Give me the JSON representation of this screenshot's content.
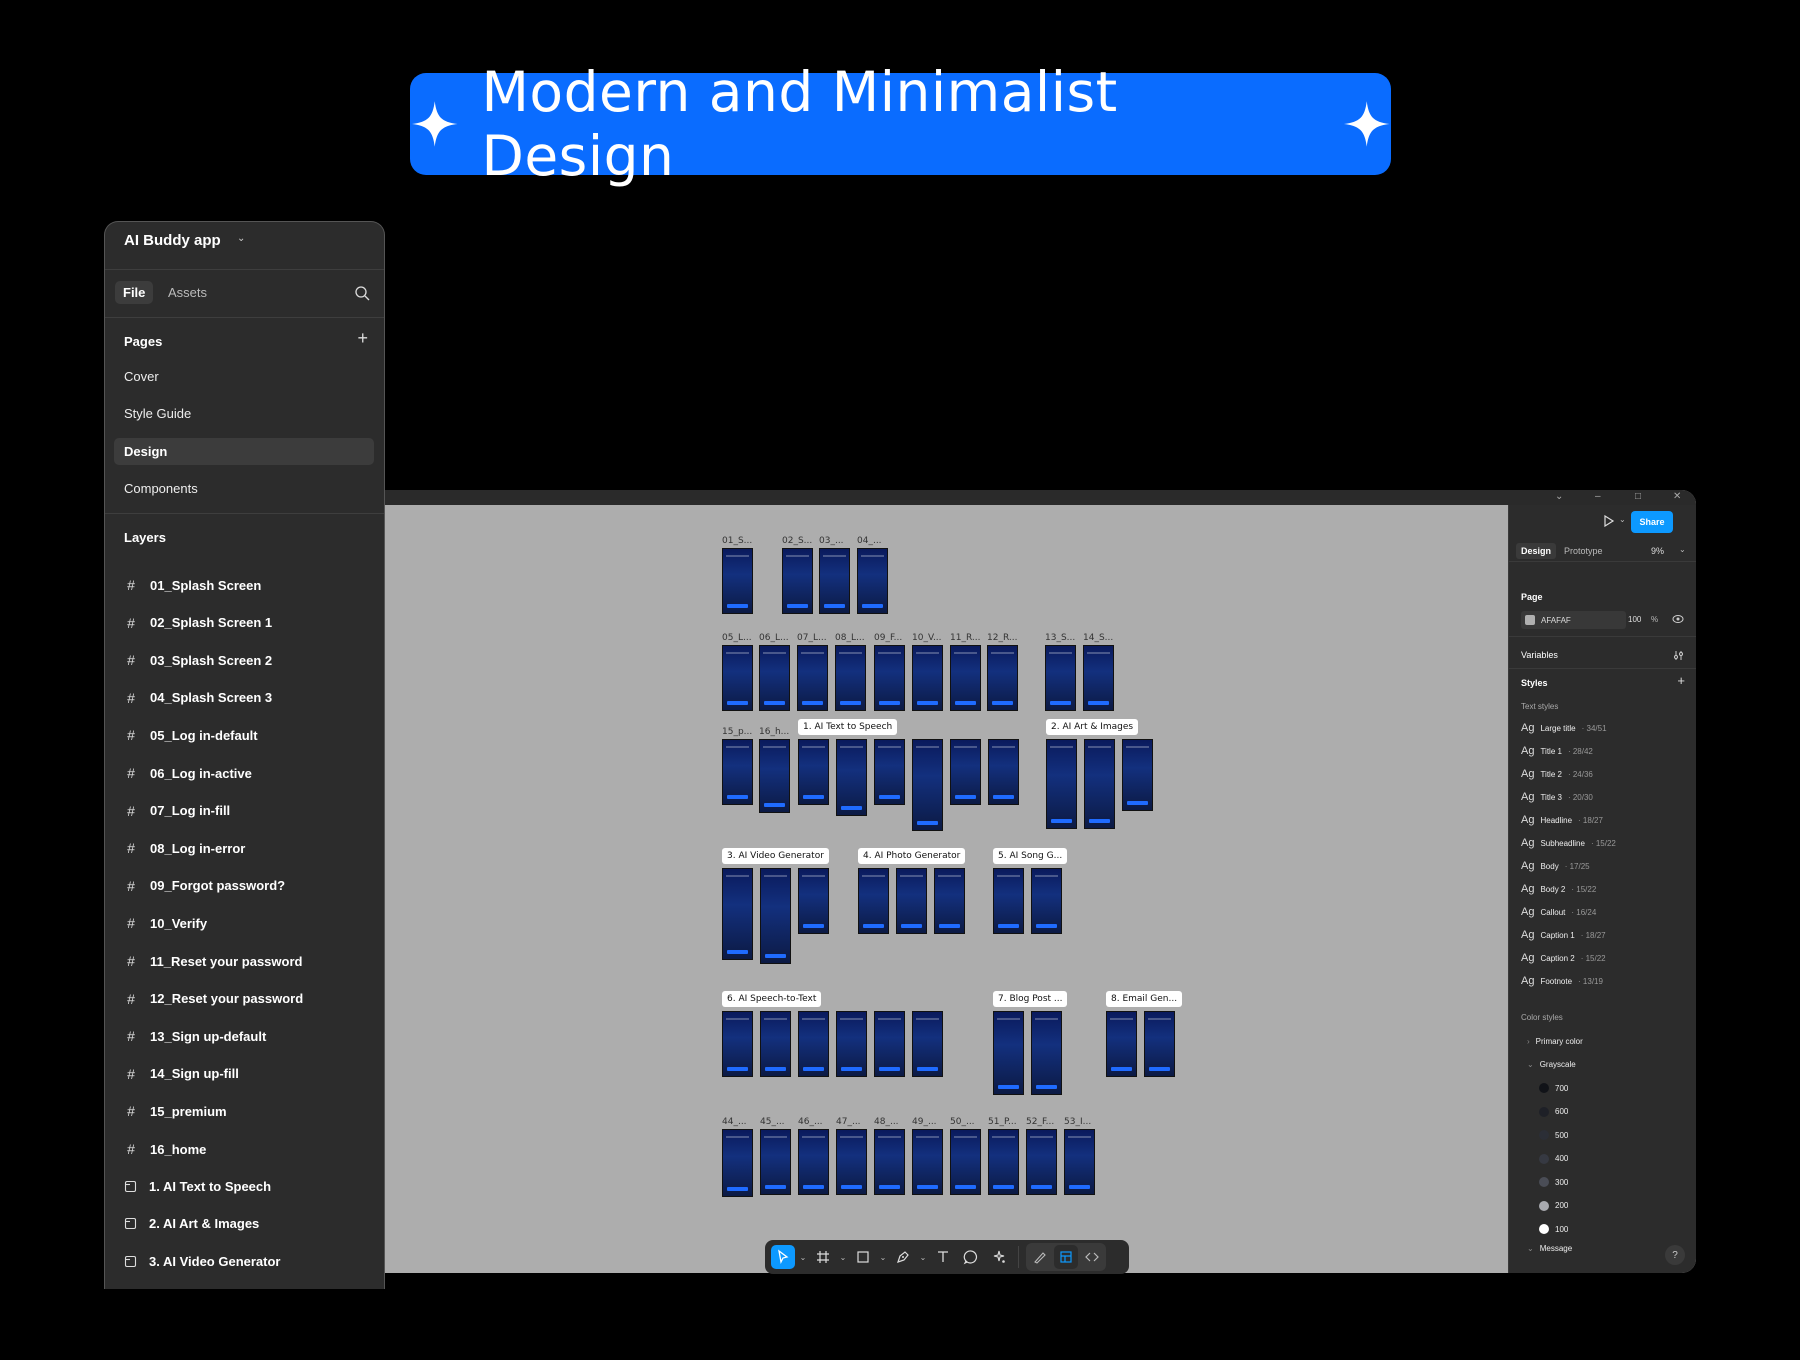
{
  "banner": {
    "title": "Modern and Minimalist Design"
  },
  "left_panel": {
    "app_name": "AI Buddy app",
    "tabs": {
      "file": "File",
      "assets": "Assets"
    },
    "pages_title": "Pages",
    "pages": [
      "Cover",
      "Style Guide",
      "Design",
      "Components"
    ],
    "selected_page": "Design",
    "layers_title": "Layers",
    "layers": [
      {
        "name": "01_Splash Screen",
        "type": "frame"
      },
      {
        "name": "02_Splash Screen 1",
        "type": "frame"
      },
      {
        "name": "03_Splash Screen 2",
        "type": "frame"
      },
      {
        "name": "04_Splash Screen 3",
        "type": "frame"
      },
      {
        "name": "05_Log in-default",
        "type": "frame"
      },
      {
        "name": "06_Log in-active",
        "type": "frame"
      },
      {
        "name": "07_Log in-fill",
        "type": "frame"
      },
      {
        "name": "08_Log in-error",
        "type": "frame"
      },
      {
        "name": "09_Forgot password?",
        "type": "frame"
      },
      {
        "name": "10_Verify",
        "type": "frame"
      },
      {
        "name": "11_Reset your password",
        "type": "frame"
      },
      {
        "name": "12_Reset your password",
        "type": "frame"
      },
      {
        "name": "13_Sign up-default",
        "type": "frame"
      },
      {
        "name": "14_Sign up-fill",
        "type": "frame"
      },
      {
        "name": "15_premium",
        "type": "frame"
      },
      {
        "name": "16_home",
        "type": "frame"
      },
      {
        "name": "1. AI Text to Speech",
        "type": "section"
      },
      {
        "name": "2. AI Art &  Images",
        "type": "section"
      },
      {
        "name": "3. AI Video Generator",
        "type": "section"
      },
      {
        "name": "4. AI Photo Generator",
        "type": "section"
      }
    ]
  },
  "canvas": {
    "frame_labels": {
      "row1": [
        "01_S...",
        "02_S...",
        "03_...",
        "04_..."
      ],
      "row2": [
        "05_L...",
        "06_L...",
        "07_L...",
        "08_L...",
        "09_F...",
        "10_V...",
        "11_R...",
        "12_R...",
        "13_S...",
        "14_S..."
      ],
      "row3": [
        "15_p...",
        "16_h..."
      ],
      "row6": [
        "44_...",
        "45_...",
        "46_...",
        "47_...",
        "48_...",
        "49_...",
        "50_...",
        "51_P...",
        "52_F...",
        "53_I..."
      ]
    },
    "sections": [
      "1. AI Text to Speech",
      "2. AI Art &  Images",
      "3. AI Video Generator",
      "4. AI Photo Generator",
      "5. AI Song G...",
      "6. AI Speech-to-Text",
      "7. Blog Post ...",
      "8. Email Gen..."
    ]
  },
  "toolbar": {
    "tools": [
      "move-tool",
      "frame-tool",
      "shape-tool",
      "pen-tool",
      "text-tool",
      "comment-tool",
      "actions-tool",
      "draw-mode",
      "design-mode",
      "dev-mode"
    ],
    "active": "move-tool"
  },
  "right_panel": {
    "share_label": "Share",
    "tabs": {
      "design": "Design",
      "prototype": "Prototype"
    },
    "zoom": "9%",
    "page_section": "Page",
    "page_fill": {
      "hex": "AFAFAF",
      "opacity": "100",
      "unit": "%"
    },
    "variables_label": "Variables",
    "styles_label": "Styles",
    "text_styles_label": "Text styles",
    "text_styles": [
      {
        "ag": "Ag",
        "name": "Large title",
        "spec": "· 34/51"
      },
      {
        "ag": "Ag",
        "name": "Title 1",
        "spec": "· 28/42"
      },
      {
        "ag": "Ag",
        "name": "Title 2",
        "spec": "· 24/36"
      },
      {
        "ag": "Ag",
        "name": "Title 3",
        "spec": "· 20/30"
      },
      {
        "ag": "Ag",
        "name": "Headline",
        "spec": "· 18/27"
      },
      {
        "ag": "Ag",
        "name": "Subheadline",
        "spec": "· 15/22"
      },
      {
        "ag": "Ag",
        "name": "Body",
        "spec": "· 17/25"
      },
      {
        "ag": "Ag",
        "name": "Body 2",
        "spec": "· 15/22"
      },
      {
        "ag": "Ag",
        "name": "Callout",
        "spec": "· 16/24"
      },
      {
        "ag": "Ag",
        "name": "Caption 1",
        "spec": "· 18/27"
      },
      {
        "ag": "Ag",
        "name": "Caption 2",
        "spec": "· 15/22"
      },
      {
        "ag": "Ag",
        "name": "Footnote",
        "spec": "· 13/19"
      }
    ],
    "color_styles_label": "Color styles",
    "color_groups": {
      "primary": "Primary color",
      "grayscale": "Grayscale",
      "message": "Message"
    },
    "grayscale": [
      {
        "name": "700",
        "color": "#111318"
      },
      {
        "name": "600",
        "color": "#1e2027"
      },
      {
        "name": "500",
        "color": "#2b2e36"
      },
      {
        "name": "400",
        "color": "#363942"
      },
      {
        "name": "300",
        "color": "#4a4d56"
      },
      {
        "name": "200",
        "color": "#a9abb0"
      },
      {
        "name": "100",
        "color": "#ffffff"
      }
    ],
    "help": "?"
  },
  "colors": {
    "accent": "#0a6cff",
    "share": "#0d99ff",
    "canvas": "#afafaf"
  }
}
